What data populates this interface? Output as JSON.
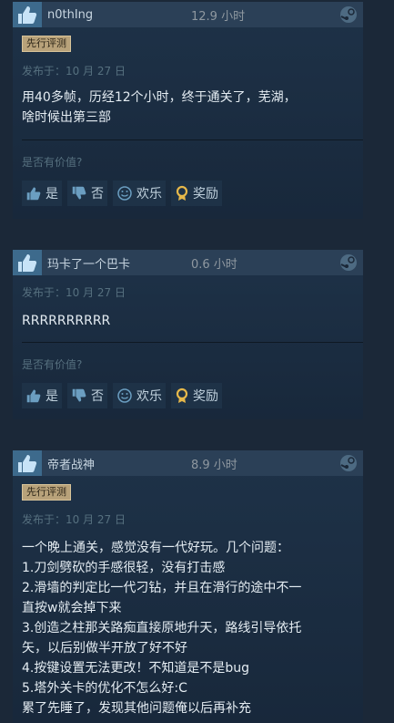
{
  "reviews": [
    {
      "username": "n0thIng",
      "hours": "12.9 小时",
      "badge": "先行评测",
      "date": "发布于：10 月 27 日",
      "lines": [
        "用40多帧，历经12个小时，终于通关了，芜湖，",
        "啥时候出第三部"
      ],
      "helpful_q": "是否有价值?",
      "yes": "是",
      "no": "否",
      "funny": "欢乐",
      "award": "奖励"
    },
    {
      "username": "玛卡了一个巴卡",
      "hours": "0.6 小时",
      "date": "发布于：10 月 27 日",
      "lines": [
        "RRRRRRRRRR"
      ],
      "helpful_q": "是否有价值?",
      "yes": "是",
      "no": "否",
      "funny": "欢乐",
      "award": "奖励"
    },
    {
      "username": "帝者战神",
      "hours": "8.9 小时",
      "badge": "先行评测",
      "date": "发布于：10 月 27 日",
      "lines": [
        "一个晚上通关，感觉没有一代好玩。几个问题：",
        "1.刀剑劈砍的手感很轻，没有打击感",
        "2.滑墙的判定比一代刁钻，并且在滑行的途中不一",
        "直按w就会掉下来",
        "3.创造之柱那关路痴直接原地升天，路线引导依托",
        "矢，以后别做半开放了好不好",
        "4.按键设置无法更改！不知道是不是bug",
        "5.塔外关卡的优化不怎么好:C",
        "累了先睡了，发现其他问题俺以后再补充"
      ]
    }
  ],
  "colors": {
    "accent": "#66c0f4",
    "badge": "#b8a27a",
    "award": "#e6b84a"
  },
  "icons": {
    "thumb": "thumb-up-icon",
    "steam": "steam-logo-icon"
  }
}
